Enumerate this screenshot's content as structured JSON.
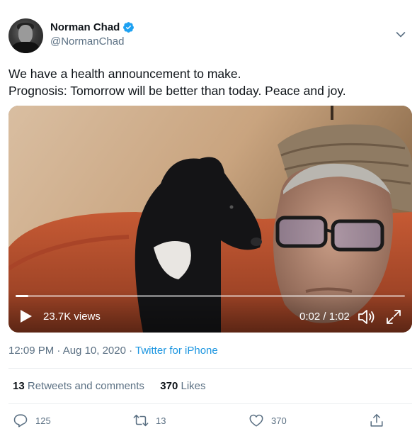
{
  "author": {
    "display_name": "Norman Chad",
    "handle": "@NormanChad",
    "verified": true,
    "avatar_icon": "avatar"
  },
  "tweet": {
    "lines": [
      "We have a health announcement to make.",
      "Prognosis: Tomorrow will be better than today. Peace and joy."
    ]
  },
  "video": {
    "views": "23.7K views",
    "time": "0:02 / 1:02",
    "progress_fraction": 0.032
  },
  "meta": {
    "timestamp": "12:09 PM · Aug 10, 2020",
    "separator": " · ",
    "source": "Twitter for iPhone"
  },
  "stats": {
    "retweets_count": "13",
    "retweets_label": "Retweets and comments",
    "likes_count": "370",
    "likes_label": "Likes"
  },
  "actions": {
    "reply_count": "125",
    "retweet_count": "13",
    "like_count": "370"
  },
  "colors": {
    "accent": "#1b95e0",
    "secondary_text": "#5b7083",
    "verified": "#1da1f2"
  }
}
